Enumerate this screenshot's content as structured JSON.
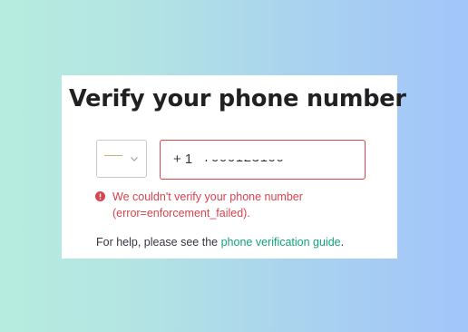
{
  "card": {
    "title": "Verify your phone number"
  },
  "country_selector": {
    "icon": "chevron-down-icon"
  },
  "phone_input": {
    "dial_code": "+ 1",
    "number": "7000123100"
  },
  "error": {
    "icon": "error-icon",
    "line1": "We couldn't verify your phone number",
    "line2": "(error=enforcement_failed)."
  },
  "help": {
    "prefix": "For help, please see the ",
    "link_text": "phone verification guide",
    "suffix": "."
  },
  "colors": {
    "accent": "#10a37f",
    "error": "#d9434e",
    "text": "#353740",
    "title": "#202123"
  }
}
